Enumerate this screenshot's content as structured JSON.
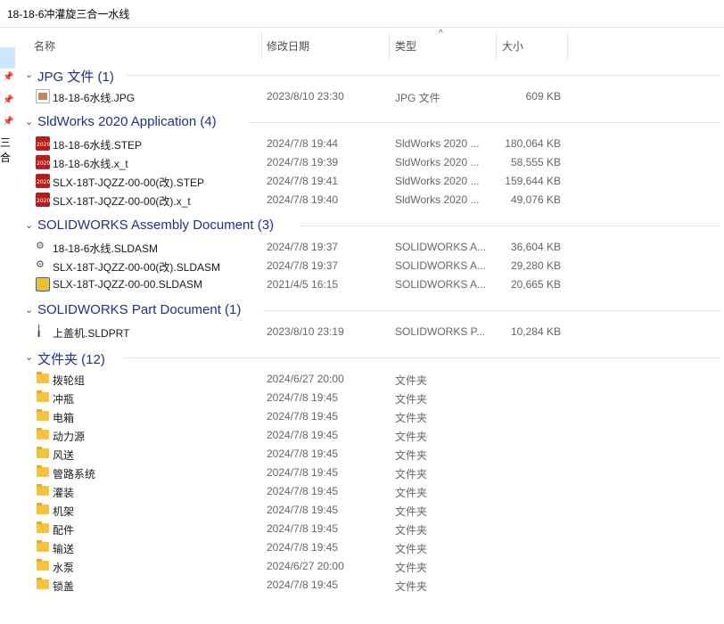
{
  "window": {
    "title": "18-18-6冲灌旋三合一水线"
  },
  "nav": {
    "partial_text": "三合"
  },
  "columns": {
    "name": "名称",
    "date": "修改日期",
    "type": "类型",
    "size": "大小"
  },
  "groups": [
    {
      "title": "JPG 文件 (1)",
      "items": [
        {
          "name": "18-18-6水线.JPG",
          "date": "2023/8/10 23:30",
          "type": "JPG 文件",
          "size": "609 KB",
          "icon": "jpg-icon"
        }
      ]
    },
    {
      "title": "SldWorks 2020 Application (4)",
      "items": [
        {
          "name": "18-18-6水线.STEP",
          "date": "2024/7/8 19:44",
          "type": "SldWorks 2020 ...",
          "size": "180,064 KB",
          "icon": "solidworks-icon"
        },
        {
          "name": "18-18-6水线.x_t",
          "date": "2024/7/8 19:39",
          "type": "SldWorks 2020 ...",
          "size": "58,555 KB",
          "icon": "solidworks-icon"
        },
        {
          "name": "SLX-18T-JQZZ-00-00(改).STEP",
          "date": "2024/7/8 19:41",
          "type": "SldWorks 2020 ...",
          "size": "159,644 KB",
          "icon": "solidworks-icon"
        },
        {
          "name": "SLX-18T-JQZZ-00-00(改).x_t",
          "date": "2024/7/8 19:40",
          "type": "SldWorks 2020 ...",
          "size": "49,076 KB",
          "icon": "solidworks-icon"
        }
      ]
    },
    {
      "title": "SOLIDWORKS Assembly Document (3)",
      "items": [
        {
          "name": "18-18-6水线.SLDASM",
          "date": "2024/7/8 19:37",
          "type": "SOLIDWORKS A...",
          "size": "36,604 KB",
          "icon": "assembly-icon"
        },
        {
          "name": "SLX-18T-JQZZ-00-00(改).SLDASM",
          "date": "2024/7/8 19:37",
          "type": "SOLIDWORKS A...",
          "size": "29,280 KB",
          "icon": "assembly-icon"
        },
        {
          "name": "SLX-18T-JQZZ-00-00.SLDASM",
          "date": "2021/4/5 16:15",
          "type": "SOLIDWORKS A...",
          "size": "20,665 KB",
          "icon": "assembly-thumbnail-icon"
        }
      ]
    },
    {
      "title": "SOLIDWORKS Part Document (1)",
      "items": [
        {
          "name": "上盖机.SLDPRT",
          "date": "2023/8/10 23:19",
          "type": "SOLIDWORKS P...",
          "size": "10,284 KB",
          "icon": "part-icon"
        }
      ]
    },
    {
      "title": "文件夹 (12)",
      "items": [
        {
          "name": "拨轮组",
          "date": "2024/6/27 20:00",
          "type": "文件夹",
          "size": "",
          "icon": "folder-icon"
        },
        {
          "name": "冲瓶",
          "date": "2024/7/8 19:45",
          "type": "文件夹",
          "size": "",
          "icon": "folder-icon"
        },
        {
          "name": "电箱",
          "date": "2024/7/8 19:45",
          "type": "文件夹",
          "size": "",
          "icon": "folder-icon"
        },
        {
          "name": "动力源",
          "date": "2024/7/8 19:45",
          "type": "文件夹",
          "size": "",
          "icon": "folder-icon"
        },
        {
          "name": "风送",
          "date": "2024/7/8 19:45",
          "type": "文件夹",
          "size": "",
          "icon": "folder-icon"
        },
        {
          "name": "管路系统",
          "date": "2024/7/8 19:45",
          "type": "文件夹",
          "size": "",
          "icon": "folder-icon"
        },
        {
          "name": "灌装",
          "date": "2024/7/8 19:45",
          "type": "文件夹",
          "size": "",
          "icon": "folder-icon"
        },
        {
          "name": "机架",
          "date": "2024/7/8 19:45",
          "type": "文件夹",
          "size": "",
          "icon": "folder-icon"
        },
        {
          "name": "配件",
          "date": "2024/7/8 19:45",
          "type": "文件夹",
          "size": "",
          "icon": "folder-icon"
        },
        {
          "name": "输送",
          "date": "2024/7/8 19:45",
          "type": "文件夹",
          "size": "",
          "icon": "folder-icon"
        },
        {
          "name": "水泵",
          "date": "2024/6/27 20:00",
          "type": "文件夹",
          "size": "",
          "icon": "folder-icon"
        },
        {
          "name": "锁盖",
          "date": "2024/7/8 19:45",
          "type": "文件夹",
          "size": "",
          "icon": "folder-icon"
        }
      ]
    }
  ]
}
